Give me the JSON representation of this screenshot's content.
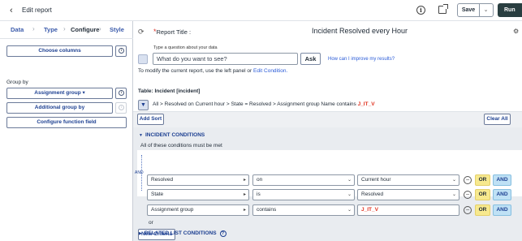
{
  "header": {
    "title": "Edit report",
    "save_label": "Save",
    "run_label": "Run"
  },
  "left_panel": {
    "tabs": [
      "Data",
      "Type",
      "Configure",
      "Style"
    ],
    "active_tab": "Configure",
    "choose_columns": "Choose columns",
    "group_by_label": "Group by",
    "group_by_value": "Assignment group",
    "additional_group_by": "Additional group by",
    "configure_function_field": "Configure function field"
  },
  "report": {
    "title_label": "Report Title :",
    "title_value": "Incident Resolved every Hour",
    "nlq_hint": "Type a question about your data",
    "nlq_placeholder": "What do you want to see?",
    "ask_label": "Ask",
    "improve_link": "How can I improve my results?",
    "modify_text": "To modify the current report, use the left panel or",
    "modify_link": "Edit Condition.",
    "table_label": "Table: Incident [incident]",
    "breadcrumb": "All > Resolved on Current hour > State = Resolved > Assignment group Name contains",
    "breadcrumb_emph": "J_IT_V"
  },
  "sort": {
    "add_sort": "Add Sort",
    "clear_all": "Clear All"
  },
  "conditions": {
    "header": "INCIDENT CONDITIONS",
    "must_met": "All of these conditions must be met",
    "and_label": "AND",
    "rows": [
      {
        "field": "Resolved",
        "operator": "on",
        "value": "Current hour",
        "value_red": false
      },
      {
        "field": "State",
        "operator": "is",
        "value": "Resolved",
        "value_red": false
      },
      {
        "field": "Assignment group",
        "operator": "contains",
        "value": "J_IT_V",
        "value_red": true
      }
    ],
    "or_btn": "OR",
    "and_btn": "AND",
    "or_label": "or",
    "new_criteria": "New Criteria",
    "related": "RELATED LIST CONDITIONS"
  }
}
